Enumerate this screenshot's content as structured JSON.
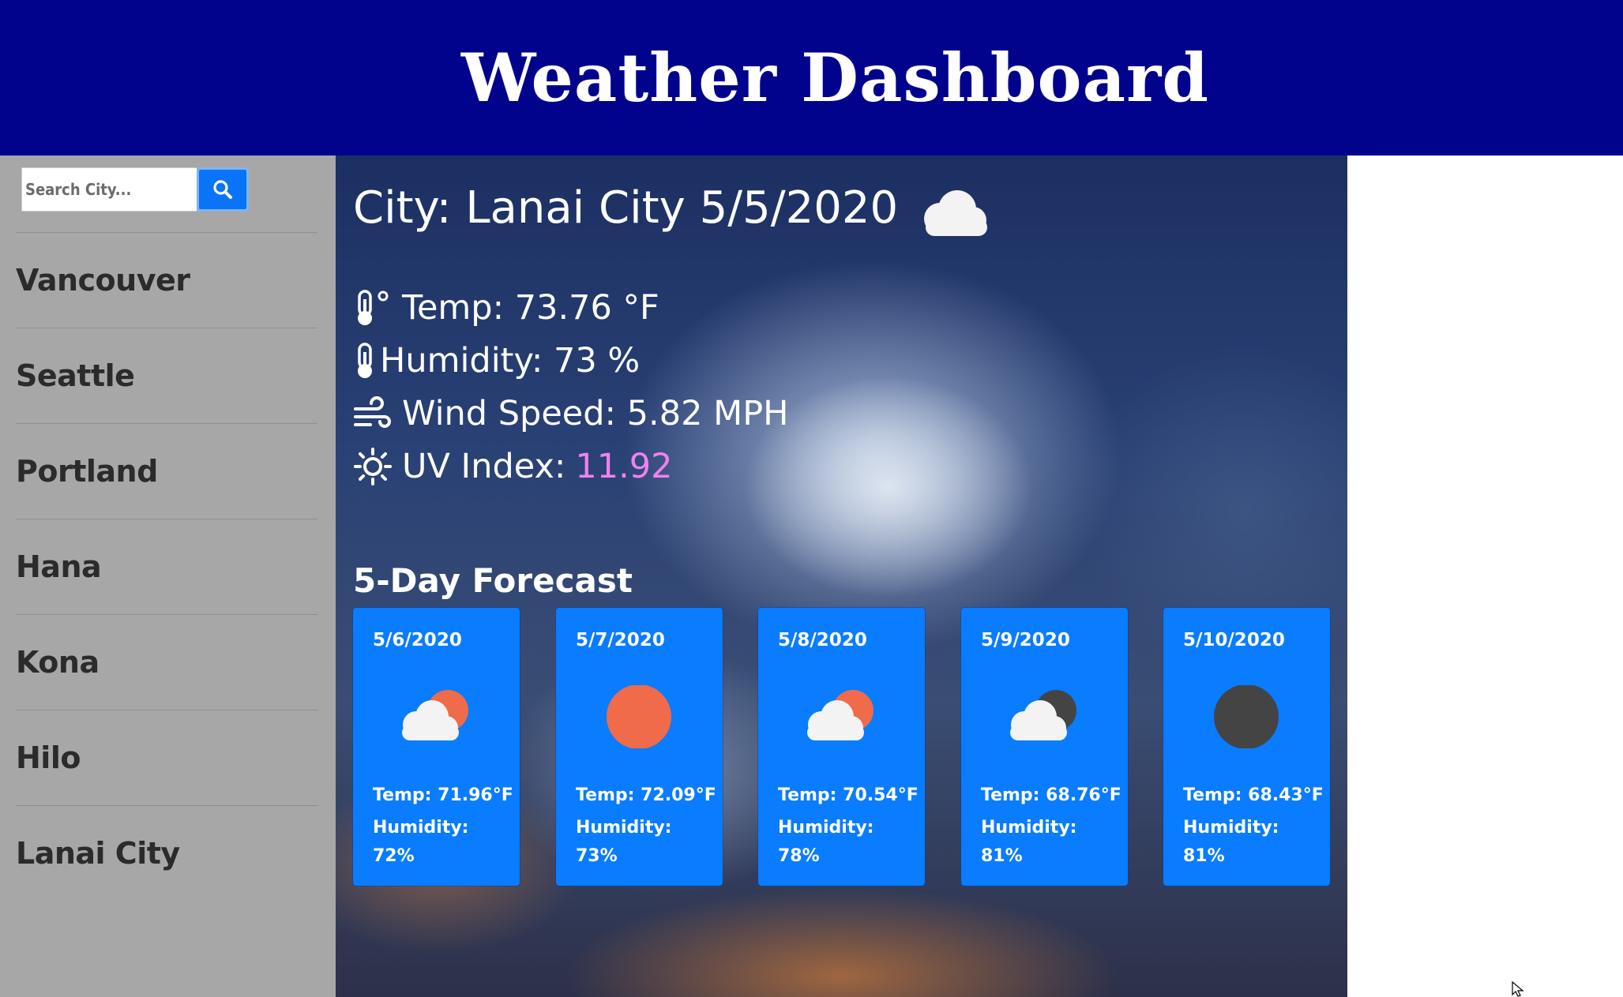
{
  "header": {
    "title": "Weather Dashboard"
  },
  "sidebar": {
    "search_placeholder": "Search City...",
    "cities": [
      "Vancouver",
      "Seattle",
      "Portland",
      "Hana",
      "Kona",
      "Hilo",
      "Lanai City"
    ]
  },
  "current": {
    "title": "City: Lanai City 5/5/2020",
    "icon": "cloud-icon",
    "temp": "Temp: 73.76 °F",
    "humidity": "Humidity: 73 %",
    "wind": "Wind Speed: 5.82 MPH",
    "uv_label": "UV Index:",
    "uv_value": "11.92",
    "uv_color": "#ee82ee"
  },
  "forecast": {
    "title": "5-Day Forecast",
    "days": [
      {
        "date": "5/6/2020",
        "icon": "cloud-sun-icon",
        "temp": "Temp: 71.96°F",
        "humidity": "Humidity: 72%"
      },
      {
        "date": "5/7/2020",
        "icon": "sun-icon",
        "temp": "Temp: 72.09°F",
        "humidity": "Humidity: 73%"
      },
      {
        "date": "5/8/2020",
        "icon": "cloud-sun-icon",
        "temp": "Temp: 70.54°F",
        "humidity": "Humidity: 78%"
      },
      {
        "date": "5/9/2020",
        "icon": "cloud-moon-icon",
        "temp": "Temp: 68.76°F",
        "humidity": "Humidity: 81%"
      },
      {
        "date": "5/10/2020",
        "icon": "moon-icon",
        "temp": "Temp: 68.43°F",
        "humidity": "Humidity: 81%"
      }
    ]
  },
  "colors": {
    "header_bg": "#01038c",
    "sidebar_bg": "#a7a7a7",
    "card_bg": "#0a7cff",
    "sun": "#ef6b4a",
    "moon": "#444444"
  }
}
